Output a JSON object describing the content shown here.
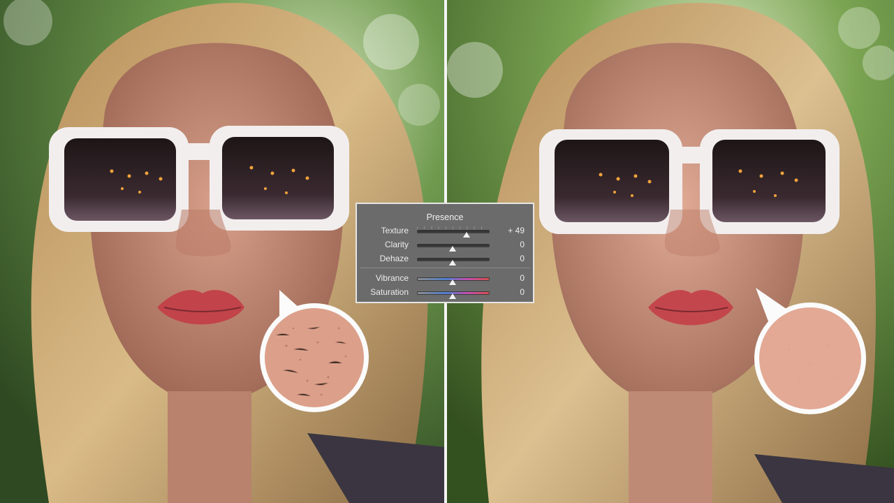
{
  "panel": {
    "title": "Presence",
    "sliders": [
      {
        "label": "Texture",
        "value": "+ 49",
        "level": 0.7,
        "color": false
      },
      {
        "label": "Clarity",
        "value": "0",
        "level": 0.5,
        "color": false
      },
      {
        "label": "Dehaze",
        "value": "0",
        "level": 0.5,
        "color": false
      },
      {
        "label": "Vibrance",
        "value": "0",
        "level": 0.5,
        "color": true
      },
      {
        "label": "Saturation",
        "value": "0",
        "level": 0.5,
        "color": true
      }
    ]
  },
  "colors": {
    "panel_bg": "#6b6b6b",
    "divider": "#f4f4f4",
    "skin_before": "#dca08a",
    "skin_after": "#e3a995"
  },
  "icons": [
    "slider-thumb"
  ]
}
